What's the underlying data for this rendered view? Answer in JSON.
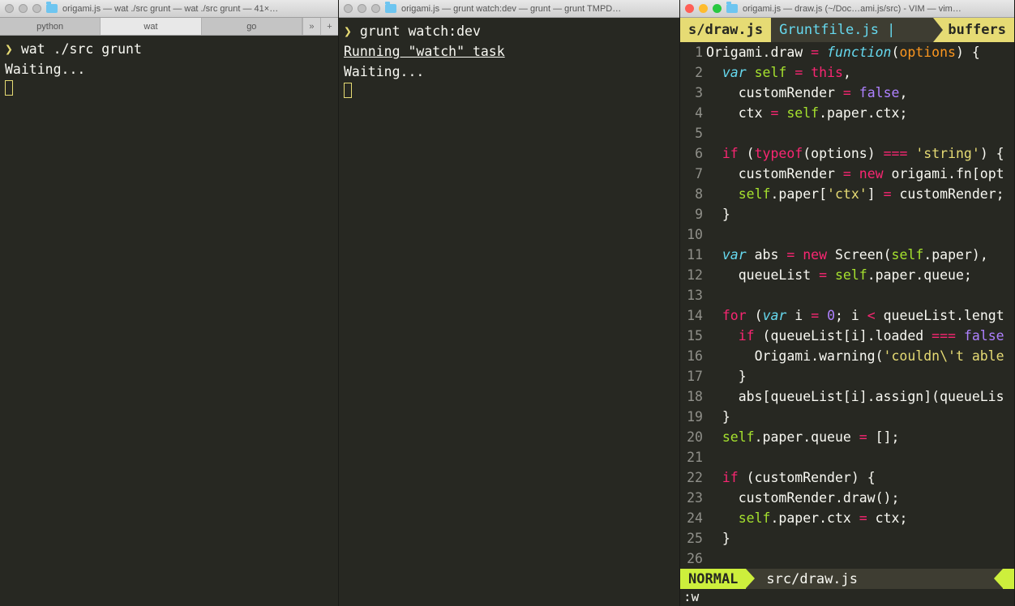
{
  "left_window": {
    "title": "origami.js — wat ./src grunt — wat ./src grunt — 41×…",
    "tabs": [
      "python",
      "wat",
      "go"
    ],
    "active_tab": 1,
    "prompt": "❯",
    "command": "wat ./src grunt",
    "waiting": "Waiting..."
  },
  "middle_window": {
    "title": "origami.js — grunt watch:dev — grunt — grunt TMPD…",
    "prompt": "❯",
    "command": "grunt watch:dev",
    "running": "Running \"watch\" task",
    "waiting": "Waiting..."
  },
  "right_window": {
    "title": "origami.js — draw.js (~/Doc…ami.js/src) - VIM — vim…",
    "tabs": {
      "active": "s/draw.js",
      "inactive": "Gruntfile.js |",
      "buffers": "buffers"
    },
    "status": {
      "mode": "NORMAL",
      "file": "src/draw.js"
    },
    "cmdline": ":w",
    "code_lines": [
      {
        "n": 1,
        "tokens": [
          [
            "id",
            "Origami.draw "
          ],
          [
            "op",
            "="
          ],
          [
            "id",
            " "
          ],
          [
            "fn",
            "function"
          ],
          [
            "id",
            "("
          ],
          [
            "param",
            "options"
          ],
          [
            "id",
            ") {"
          ]
        ]
      },
      {
        "n": 2,
        "tokens": [
          [
            "id",
            "  "
          ],
          [
            "st",
            "var"
          ],
          [
            "id",
            " "
          ],
          [
            "def",
            "self"
          ],
          [
            "id",
            " "
          ],
          [
            "op",
            "="
          ],
          [
            "id",
            " "
          ],
          [
            "kw",
            "this"
          ],
          [
            "id",
            ","
          ]
        ]
      },
      {
        "n": 3,
        "tokens": [
          [
            "id",
            "    customRender "
          ],
          [
            "op",
            "="
          ],
          [
            "id",
            " "
          ],
          [
            "bool",
            "false"
          ],
          [
            "id",
            ","
          ]
        ]
      },
      {
        "n": 4,
        "tokens": [
          [
            "id",
            "    ctx "
          ],
          [
            "op",
            "="
          ],
          [
            "id",
            " "
          ],
          [
            "def",
            "self"
          ],
          [
            "id",
            ".paper.ctx;"
          ]
        ]
      },
      {
        "n": 5,
        "tokens": [
          [
            "id",
            ""
          ]
        ]
      },
      {
        "n": 6,
        "tokens": [
          [
            "id",
            "  "
          ],
          [
            "kw",
            "if"
          ],
          [
            "id",
            " ("
          ],
          [
            "kw",
            "typeof"
          ],
          [
            "id",
            "(options) "
          ],
          [
            "op",
            "==="
          ],
          [
            "id",
            " "
          ],
          [
            "str",
            "'string'"
          ],
          [
            "id",
            ") {"
          ]
        ]
      },
      {
        "n": 7,
        "tokens": [
          [
            "id",
            "    customRender "
          ],
          [
            "op",
            "="
          ],
          [
            "id",
            " "
          ],
          [
            "kw",
            "new"
          ],
          [
            "id",
            " origami.fn[opt"
          ]
        ]
      },
      {
        "n": 8,
        "tokens": [
          [
            "id",
            "    "
          ],
          [
            "def",
            "self"
          ],
          [
            "id",
            ".paper["
          ],
          [
            "str",
            "'ctx'"
          ],
          [
            "id",
            "] "
          ],
          [
            "op",
            "="
          ],
          [
            "id",
            " customRender;"
          ]
        ]
      },
      {
        "n": 9,
        "tokens": [
          [
            "id",
            "  }"
          ]
        ]
      },
      {
        "n": 10,
        "tokens": [
          [
            "id",
            ""
          ]
        ]
      },
      {
        "n": 11,
        "tokens": [
          [
            "id",
            "  "
          ],
          [
            "st",
            "var"
          ],
          [
            "id",
            " abs "
          ],
          [
            "op",
            "="
          ],
          [
            "id",
            " "
          ],
          [
            "kw",
            "new"
          ],
          [
            "id",
            " Screen("
          ],
          [
            "def",
            "self"
          ],
          [
            "id",
            ".paper),"
          ]
        ]
      },
      {
        "n": 12,
        "tokens": [
          [
            "id",
            "    queueList "
          ],
          [
            "op",
            "="
          ],
          [
            "id",
            " "
          ],
          [
            "def",
            "self"
          ],
          [
            "id",
            ".paper.queue;"
          ]
        ]
      },
      {
        "n": 13,
        "tokens": [
          [
            "id",
            ""
          ]
        ]
      },
      {
        "n": 14,
        "tokens": [
          [
            "id",
            "  "
          ],
          [
            "kw",
            "for"
          ],
          [
            "id",
            " ("
          ],
          [
            "st",
            "var"
          ],
          [
            "id",
            " i "
          ],
          [
            "op",
            "="
          ],
          [
            "id",
            " "
          ],
          [
            "num",
            "0"
          ],
          [
            "id",
            "; i "
          ],
          [
            "op",
            "<"
          ],
          [
            "id",
            " queueList.lengt"
          ]
        ]
      },
      {
        "n": 15,
        "tokens": [
          [
            "id",
            "    "
          ],
          [
            "kw",
            "if"
          ],
          [
            "id",
            " (queueList[i].loaded "
          ],
          [
            "op",
            "==="
          ],
          [
            "id",
            " "
          ],
          [
            "bool",
            "false"
          ]
        ]
      },
      {
        "n": 16,
        "tokens": [
          [
            "id",
            "      Origami.warning("
          ],
          [
            "str",
            "'couldn\\'t able"
          ]
        ]
      },
      {
        "n": 17,
        "tokens": [
          [
            "id",
            "    }"
          ]
        ]
      },
      {
        "n": 18,
        "tokens": [
          [
            "id",
            "    abs[queueList[i].assign](queueLis"
          ]
        ]
      },
      {
        "n": 19,
        "tokens": [
          [
            "id",
            "  }"
          ]
        ]
      },
      {
        "n": 20,
        "tokens": [
          [
            "id",
            "  "
          ],
          [
            "def",
            "self"
          ],
          [
            "id",
            ".paper.queue "
          ],
          [
            "op",
            "="
          ],
          [
            "id",
            " [];"
          ]
        ]
      },
      {
        "n": 21,
        "tokens": [
          [
            "id",
            ""
          ]
        ]
      },
      {
        "n": 22,
        "tokens": [
          [
            "id",
            "  "
          ],
          [
            "kw",
            "if"
          ],
          [
            "id",
            " (customRender) {"
          ]
        ]
      },
      {
        "n": 23,
        "tokens": [
          [
            "id",
            "    customRender.draw();"
          ]
        ]
      },
      {
        "n": 24,
        "tokens": [
          [
            "id",
            "    "
          ],
          [
            "def",
            "self"
          ],
          [
            "id",
            ".paper.ctx "
          ],
          [
            "op",
            "="
          ],
          [
            "id",
            " ctx;"
          ]
        ]
      },
      {
        "n": 25,
        "tokens": [
          [
            "id",
            "  }"
          ]
        ]
      },
      {
        "n": 26,
        "tokens": [
          [
            "id",
            ""
          ]
        ]
      }
    ]
  }
}
